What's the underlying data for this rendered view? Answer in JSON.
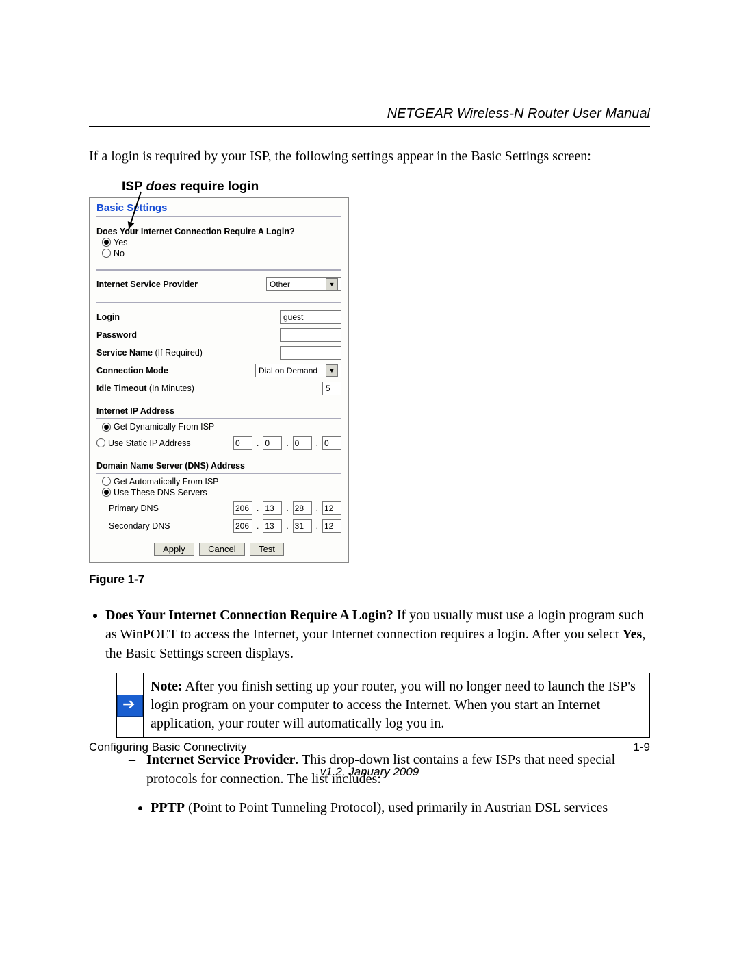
{
  "header": {
    "title": "NETGEAR Wireless-N Router User Manual"
  },
  "intro": "If a login is required by your ISP, the following settings appear in the Basic Settings screen:",
  "callout": {
    "prefix": "ISP ",
    "em": "does",
    "suffix": " require login"
  },
  "panel": {
    "title": "Basic Settings",
    "login_q": "Does Your Internet Connection Require A Login?",
    "opt_yes": "Yes",
    "opt_no": "No",
    "isp_label": "Internet Service Provider",
    "isp_value": "Other",
    "login_label": "Login",
    "login_value": "guest",
    "pw_label": "Password",
    "svc_label_a": "Service Name ",
    "svc_label_b": "(If Required)",
    "conn_label": "Connection Mode",
    "conn_value": "Dial on Demand",
    "idle_label_a": "Idle Timeout ",
    "idle_label_b": "(In Minutes)",
    "idle_value": "5",
    "ip_head": "Internet IP Address",
    "ip_dyn": "Get Dynamically From ISP",
    "ip_static": "Use Static IP Address",
    "ip": [
      "0",
      "0",
      "0",
      "0"
    ],
    "dns_head": "Domain Name Server (DNS) Address",
    "dns_auto": "Get Automatically From ISP",
    "dns_use": "Use These DNS Servers",
    "dns_p_label": "Primary DNS",
    "dns_p": [
      "206",
      "13",
      "28",
      "12"
    ],
    "dns_s_label": "Secondary DNS",
    "dns_s": [
      "206",
      "13",
      "31",
      "12"
    ],
    "btn_apply": "Apply",
    "btn_cancel": "Cancel",
    "btn_test": "Test"
  },
  "fig_cap": "Figure 1-7",
  "body": {
    "b1_bold": "Does Your Internet Connection Require A Login?",
    "b1_rest": " If you usually must use a login program such as WinPOET to access the Internet, your Internet connection requires a login. After you select ",
    "b1_yes": "Yes",
    "b1_tail": ", the Basic Settings screen displays.",
    "note_bold": "Note:",
    "note_rest": " After you finish setting up your router, you will no longer need to launch the ISP's login program on your computer to access the Internet. When you start an Internet application, your router will automatically log you in.",
    "d1_bold": "Internet Service Provider",
    "d1_rest": ". This drop-down list contains a few ISPs that need special protocols for connection. The list includes:",
    "i1_bold": "PPTP",
    "i1_rest": " (Point to Point Tunneling Protocol), used primarily in Austrian DSL services"
  },
  "footer": {
    "left": "Configuring Basic Connectivity",
    "right": "1-9",
    "version": "v1.2, January 2009"
  }
}
